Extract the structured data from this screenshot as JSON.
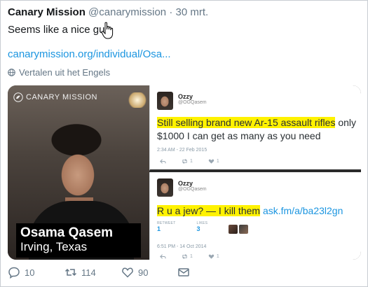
{
  "tweet": {
    "author_name": "Canary Mission",
    "author_handle": "@canarymission",
    "separator": "·",
    "timestamp": "30 mrt.",
    "text": "Seems like a nice guy.",
    "link_text": "canarymission.org/individual/Osa...",
    "translate_label": "Vertalen uit het Engels"
  },
  "media": {
    "brand_label": "CANARY MISSION",
    "caption_name": "Osama Qasem",
    "caption_location": "Irving, Texas",
    "cards": [
      {
        "name": "Ozzy",
        "handle": "@OGQasem",
        "highlight": "Still selling brand new Ar-15 assault rifles",
        "rest": " only $1000 I can get as many as you need",
        "date": "2:34 AM - 22 Feb 2015",
        "retweets": "1",
        "likes": "1"
      },
      {
        "name": "Ozzy",
        "handle": "@OGQasem",
        "highlight": "R u a jew? — I kill them",
        "link": "ask.fm/a/ba23l2gn",
        "retweet_label": "RETWEET",
        "retweet_count": "1",
        "likes_label": "LIKES",
        "likes_count": "3",
        "date": "6:51 PM - 14 Oct 2014",
        "retweets": "1",
        "likes": "1"
      }
    ]
  },
  "actions": {
    "replies": "10",
    "retweets": "114",
    "likes": "90"
  },
  "icons": [
    "globe-icon",
    "canary-bird-icon",
    "reply-icon",
    "retweet-icon",
    "heart-icon",
    "envelope-icon",
    "hand-cursor-icon"
  ],
  "colors": {
    "link": "#1b95e0",
    "highlight": "#fff200",
    "muted": "#657786"
  }
}
